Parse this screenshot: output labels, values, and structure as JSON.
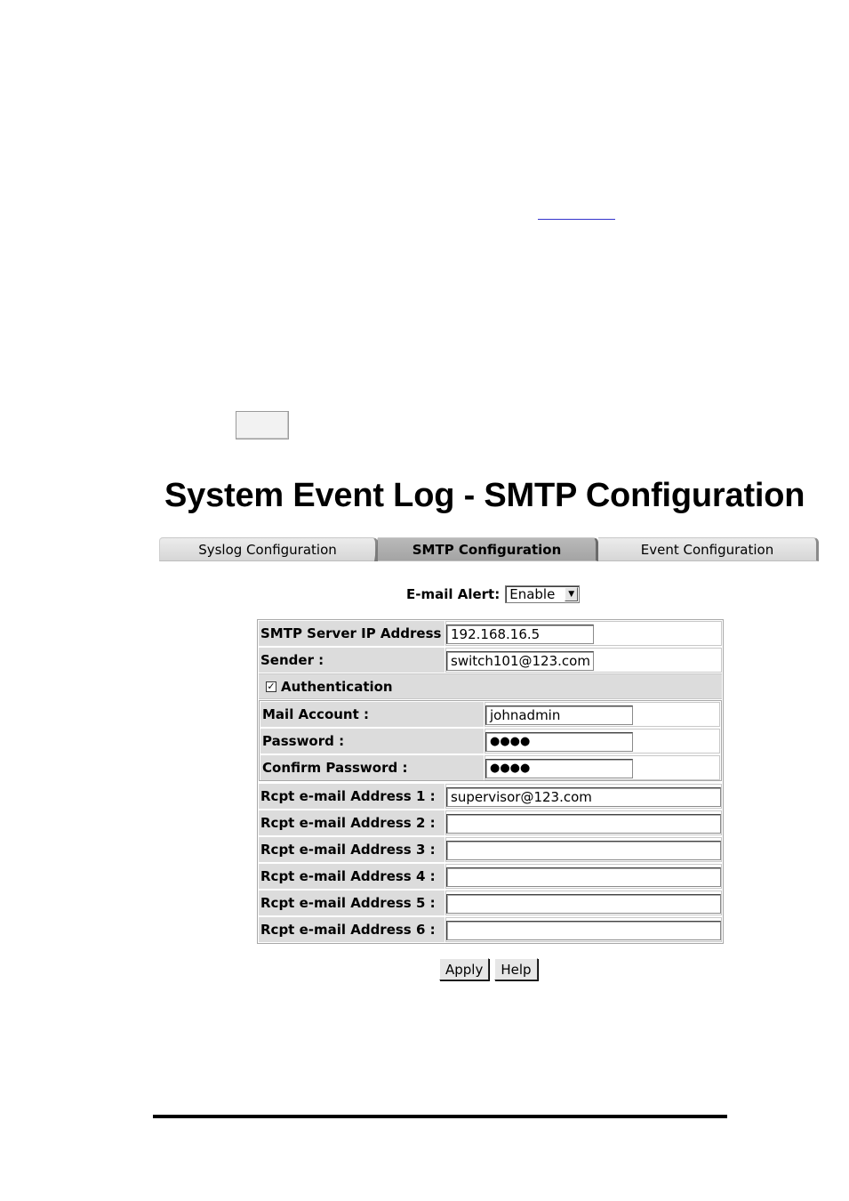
{
  "page_title": "System Event Log - SMTP Configuration",
  "tabs": [
    {
      "label": "Syslog Configuration",
      "active": false
    },
    {
      "label": "SMTP Configuration",
      "active": true
    },
    {
      "label": "Event Configuration",
      "active": false
    }
  ],
  "email_alert": {
    "label": "E-mail Alert:",
    "value": "Enable"
  },
  "form": {
    "smtp_server": {
      "label": "SMTP Server IP Address :",
      "value": "192.168.16.5"
    },
    "sender": {
      "label": "Sender :",
      "value": "switch101@123.com"
    },
    "authentication": {
      "label": "Authentication",
      "checked": true,
      "check_mark": "✓"
    },
    "mail_account": {
      "label": "Mail Account :",
      "value": "johnadmin"
    },
    "password": {
      "label": "Password :",
      "masked": "●●●●"
    },
    "confirm_password": {
      "label": "Confirm Password :",
      "masked": "●●●●"
    },
    "rcpt": [
      {
        "label": "Rcpt e-mail Address 1 :",
        "value": "supervisor@123.com"
      },
      {
        "label": "Rcpt e-mail Address 2 :",
        "value": ""
      },
      {
        "label": "Rcpt e-mail Address 3 :",
        "value": ""
      },
      {
        "label": "Rcpt e-mail Address 4 :",
        "value": ""
      },
      {
        "label": "Rcpt e-mail Address 5 :",
        "value": ""
      },
      {
        "label": "Rcpt e-mail Address 6 :",
        "value": ""
      }
    ]
  },
  "buttons": {
    "apply": "Apply",
    "help": "Help"
  }
}
